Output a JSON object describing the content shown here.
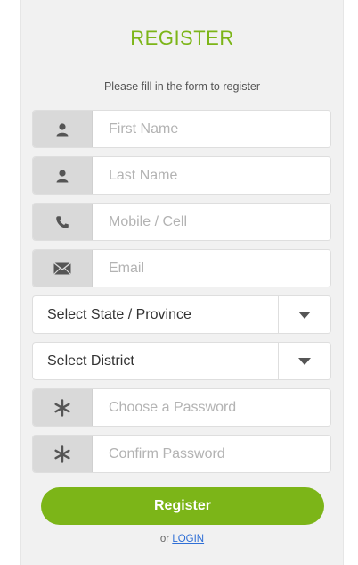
{
  "form": {
    "title": "REGISTER",
    "subtitle": "Please fill in the form to register",
    "fields": [
      {
        "icon": "user-icon",
        "placeholder": "First Name"
      },
      {
        "icon": "user-icon",
        "placeholder": "Last Name"
      },
      {
        "icon": "phone-icon",
        "placeholder": "Mobile / Cell"
      },
      {
        "icon": "envelope-icon",
        "placeholder": "Email"
      }
    ],
    "selects": [
      {
        "label": "Select State / Province"
      },
      {
        "label": "Select District"
      }
    ],
    "password": {
      "icon": "asterisk-icon",
      "placeholder": "Choose a Password"
    },
    "confirm_password": {
      "icon": "asterisk-icon",
      "placeholder": "Confirm Password"
    },
    "register_label": "Register",
    "or_text": "or",
    "login_label": "LOGIN"
  },
  "colors": {
    "accent": "#7cb518",
    "link": "#2f6fd6",
    "panel_bg": "#f1f1f1",
    "addon_bg": "#d9d9d9"
  }
}
